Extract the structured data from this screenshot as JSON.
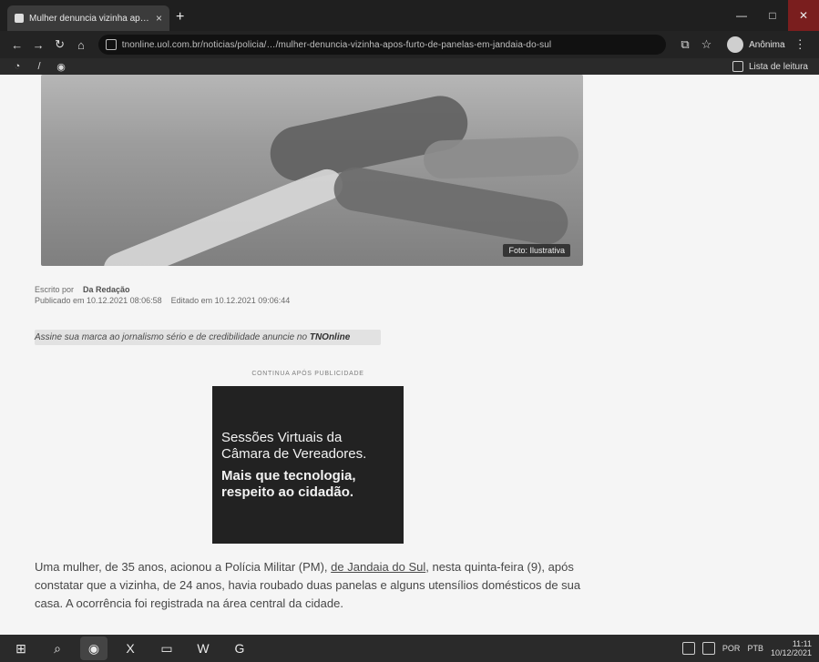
{
  "browser": {
    "tab_title": "Mulher denuncia vizinha após fu",
    "tab_close": "×",
    "new_tab": "+",
    "url_domain": "tnonline.uol.com.br",
    "url_rest": "/noticias/policia/…/mulher-denuncia-vizinha-apos-furto-de-panelas-em-jandaia-do-sul",
    "profile_name": "Anônima",
    "reading_list": "Lista de leitura"
  },
  "article": {
    "image_tag": "Foto: Ilustrativa",
    "byline_prefix": "Escrito por",
    "byline_name": "Da Redação",
    "published": "Publicado em 10.12.2021 08:06:58",
    "updated": "Editado em 10.12.2021 09:06:44",
    "promo_text": "Assine sua marca ao jornalismo sério e de credibilidade anuncie no",
    "promo_brand": "TNOnline",
    "ad_label": "CONTINUA APÓS PUBLICIDADE",
    "ad_line1": "Sessões Virtuais da",
    "ad_line2": "Câmara de Vereadores.",
    "ad_line3": "Mais que tecnologia,",
    "ad_line4": "respeito ao cidadão.",
    "para1_part1": "Uma mulher, de 35 anos, acionou a Polícia Militar (PM),",
    "para1_link": "de Jandaia do Sul",
    "para1_part2": ", nesta quinta-feira (9), após constatar que a vizinha, de 24 anos, havia roubado duas panelas e alguns utensílios domésticos de sua casa. A ocorrência foi registrada na área central da cidade."
  },
  "taskbar": {
    "lang": "POR",
    "layout": "PTB",
    "time": "11:11",
    "date": "10/12/2021"
  },
  "icons": {
    "windows": "windows-icon",
    "search": "search-icon",
    "excel": "excel-icon",
    "word": "word-icon",
    "chrome": "chrome-icon"
  }
}
